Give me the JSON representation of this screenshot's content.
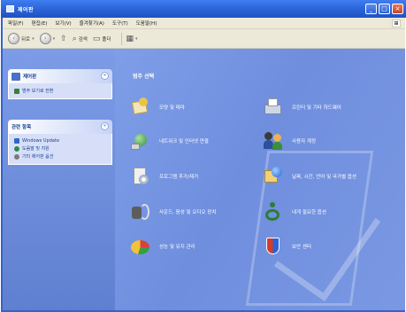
{
  "window": {
    "title": "제어판",
    "controls": [
      "_",
      "□",
      "×"
    ]
  },
  "menubar": {
    "items": [
      "파일(F)",
      "편집(E)",
      "보기(V)",
      "즐겨찾기(A)",
      "도구(T)",
      "도움말(H)"
    ]
  },
  "toolbar": {
    "back": "뒤로",
    "search": "검색",
    "folders": "폴더",
    "view_caret": "▾"
  },
  "sidebar": {
    "panel1": {
      "title": "제어판",
      "link": "범주 보기로 전환"
    },
    "panel2": {
      "title": "관련 항목",
      "links": [
        "Windows Update",
        "도움말 및 지원",
        "기타 제어판 옵션"
      ]
    }
  },
  "main": {
    "heading": "범주 선택",
    "categories_left": [
      {
        "label": "모양 및 테마",
        "icon": "appearance-themes-icon"
      },
      {
        "label": "네트워크 및 인터넷 연결",
        "icon": "network-icon"
      },
      {
        "label": "프로그램 추가/제거",
        "icon": "add-remove-programs-icon"
      },
      {
        "label": "사운드, 음성 및 오디오 장치",
        "icon": "sound-icon"
      },
      {
        "label": "성능 및 유지 관리",
        "icon": "performance-icon"
      }
    ],
    "categories_right": [
      {
        "label": "프린터 및 기타 하드웨어",
        "icon": "printers-icon"
      },
      {
        "label": "사용자 계정",
        "icon": "user-accounts-icon"
      },
      {
        "label": "날짜, 시간, 언어 및 국가별 옵션",
        "icon": "date-time-icon"
      },
      {
        "label": "내게 필요한 옵션",
        "icon": "accessibility-icon"
      },
      {
        "label": "보안 센터",
        "icon": "security-center-icon"
      }
    ]
  },
  "colors": {
    "title_blue": "#2a62d8",
    "sidebar_blue": "#6c8bd9",
    "content_blue": "#7090df"
  }
}
